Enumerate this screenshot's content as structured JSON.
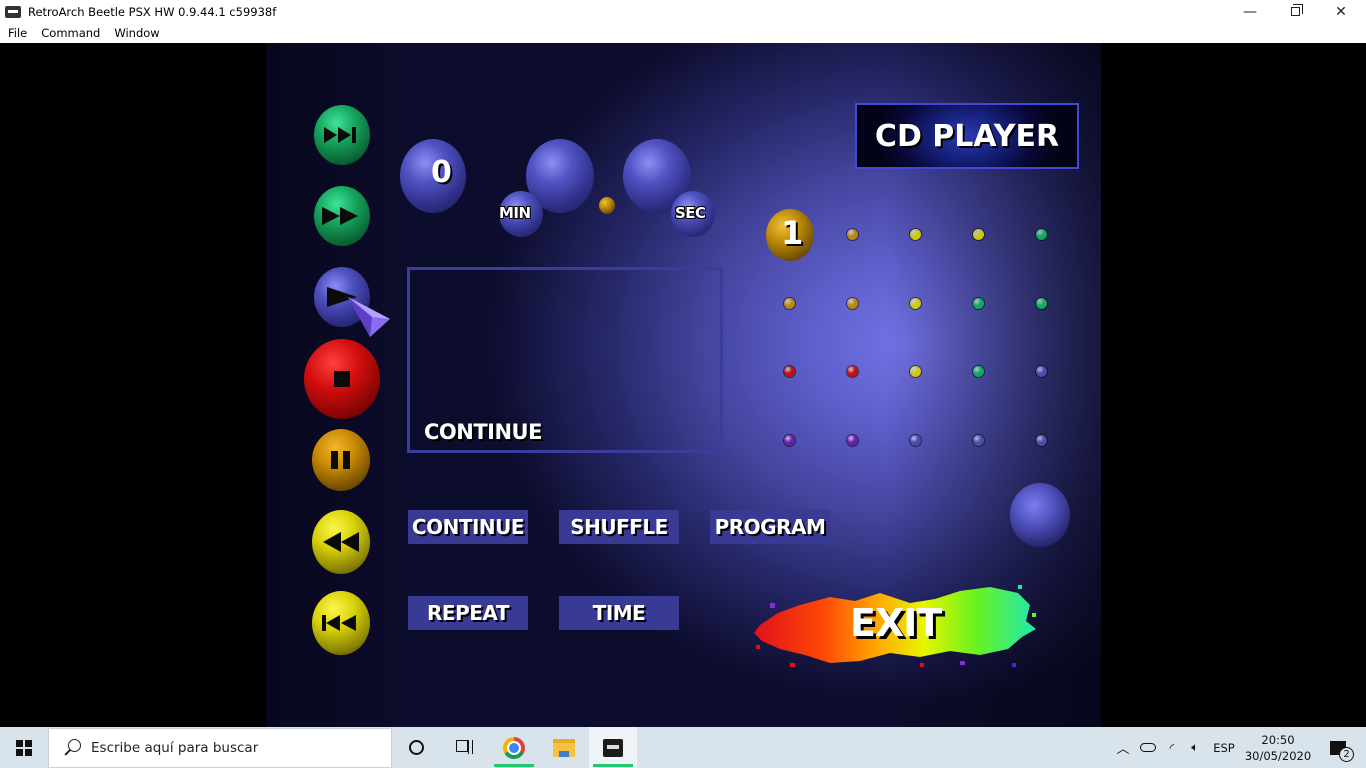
{
  "window": {
    "title": "RetroArch Beetle PSX HW 0.9.44.1 c59938f",
    "controls": {
      "minimize": "—",
      "close": "✕"
    }
  },
  "menubar": {
    "items": [
      "File",
      "Command",
      "Window"
    ]
  },
  "game": {
    "screen_title": "CD PLAYER",
    "track_number": "0",
    "time_labels": {
      "min": "MIN",
      "sec": "SEC"
    },
    "display_text": "CONTINUE",
    "current_track": "1",
    "transport_buttons": [
      {
        "name": "next-track",
        "icon": "skip-forward-icon",
        "color": "green"
      },
      {
        "name": "fast-forward",
        "icon": "fast-forward-icon",
        "color": "green"
      },
      {
        "name": "play",
        "icon": "play-icon",
        "color": "blue",
        "selected": true
      },
      {
        "name": "stop",
        "icon": "stop-icon",
        "color": "red"
      },
      {
        "name": "pause",
        "icon": "pause-icon",
        "color": "orange"
      },
      {
        "name": "rewind",
        "icon": "rewind-icon",
        "color": "yellow"
      },
      {
        "name": "previous-track",
        "icon": "skip-back-icon",
        "color": "yellow"
      }
    ],
    "mode_buttons": [
      "CONTINUE",
      "SHUFFLE",
      "PROGRAM",
      "REPEAT",
      "TIME"
    ],
    "exit_label": "EXIT",
    "track_grid": {
      "rows": [
        [
          "#b88a0a",
          "#b88a0a",
          "#cfc80c",
          "#cfc80c",
          "#12a860"
        ],
        [
          "#b88a0a",
          "#b88a0a",
          "#cfc80c",
          "#12a860",
          "#12a860"
        ],
        [
          "#c01010",
          "#c01010",
          "#cfc80c",
          "#12a860",
          "#4a4cb0"
        ],
        [
          "#6a1fa8",
          "#6a1fa8",
          "#4a4cb0",
          "#4a4cb0",
          "#4a4cb0"
        ]
      ]
    }
  },
  "taskbar": {
    "search_placeholder": "Escribe aquí para buscar",
    "apps": [
      "cortana-icon",
      "task-view-icon",
      "chrome-icon",
      "file-explorer-icon",
      "retroarch-icon"
    ],
    "tray": {
      "language": "ESP",
      "time": "20:50",
      "date": "30/05/2020",
      "notification_count": "2"
    }
  }
}
